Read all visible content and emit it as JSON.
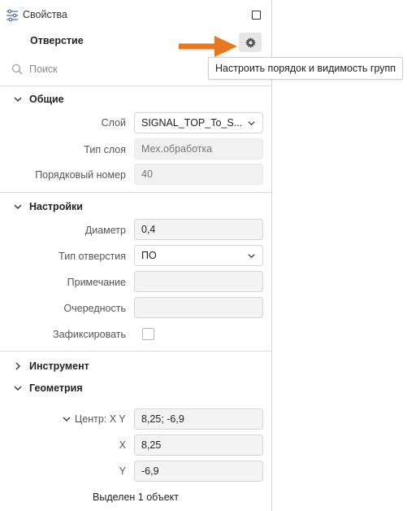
{
  "panel": {
    "title": "Свойства",
    "object_title": "Отверстие",
    "icons": {
      "panel": "sliders-icon",
      "window": "maximize-icon",
      "settings": "gear-icon"
    }
  },
  "search": {
    "placeholder": "Поиск"
  },
  "tooltip": "Настроить порядок и видимость групп",
  "groups": {
    "general": {
      "title": "Общие",
      "fields": {
        "layer": {
          "label": "Слой",
          "value": "SIGNAL_TOP_To_S..."
        },
        "layer_type": {
          "label": "Тип слоя",
          "value": "Мех.обработка"
        },
        "order_number": {
          "label": "Порядковый номер",
          "value": "40"
        }
      }
    },
    "settings": {
      "title": "Настройки",
      "fields": {
        "diameter": {
          "label": "Диаметр",
          "value": "0,4"
        },
        "hole_type": {
          "label": "Тип отверстия",
          "value": "ПО"
        },
        "note": {
          "label": "Примечание",
          "value": ""
        },
        "order": {
          "label": "Очередность",
          "value": ""
        },
        "lock": {
          "label": "Зафиксировать",
          "checked": false
        }
      }
    },
    "tool": {
      "title": "Инструмент"
    },
    "geometry": {
      "title": "Геометрия",
      "fields": {
        "center": {
          "label": "Центр: X Y",
          "value": "8,25; -6,9"
        },
        "x": {
          "label": "X",
          "value": "8,25"
        },
        "y": {
          "label": "Y",
          "value": "-6,9"
        }
      }
    }
  },
  "status": "Выделен 1 объект",
  "colors": {
    "arrow": "#e87722",
    "gear_bg": "#e6e6e6"
  }
}
